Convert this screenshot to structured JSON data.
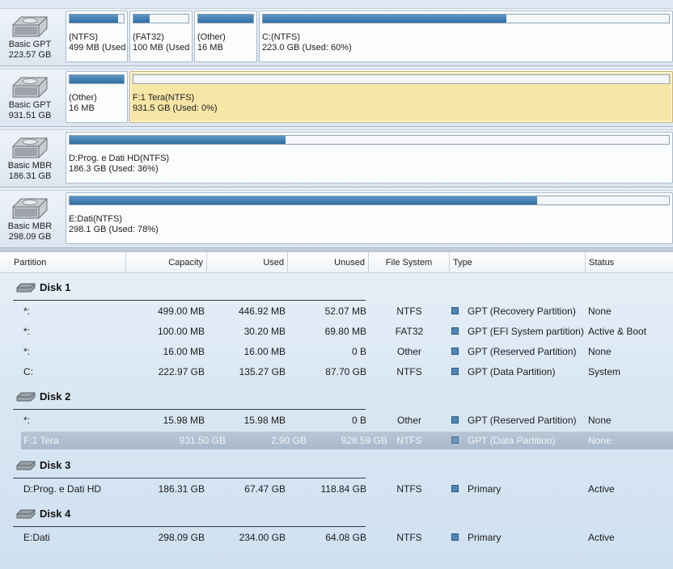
{
  "disks_map": [
    {
      "type": "Basic GPT",
      "size": "223.57 GB",
      "partitions": [
        {
          "name": "(NTFS)",
          "detail": "499 MB (Used:",
          "used_fraction": 0.9,
          "selected": false
        },
        {
          "name": "(FAT32)",
          "detail": "100 MB (Used:",
          "used_fraction": 0.3,
          "selected": false
        },
        {
          "name": "(Other)",
          "detail": "16 MB",
          "used_fraction": 1.0,
          "selected": false
        },
        {
          "name": "C:(NTFS)",
          "detail": "223.0 GB (Used: 60%)",
          "used_fraction": 0.6,
          "selected": false
        }
      ]
    },
    {
      "type": "Basic GPT",
      "size": "931.51 GB",
      "partitions": [
        {
          "name": "(Other)",
          "detail": "16 MB",
          "used_fraction": 1.0,
          "selected": false
        },
        {
          "name": "F:1 Tera(NTFS)",
          "detail": "931.5 GB (Used: 0%)",
          "used_fraction": 0.0,
          "selected": true
        }
      ]
    },
    {
      "type": "Basic MBR",
      "size": "186.31 GB",
      "partitions": [
        {
          "name": "D:Prog. e Dati HD(NTFS)",
          "detail": "186.3 GB (Used: 36%)",
          "used_fraction": 0.36,
          "selected": false
        }
      ]
    },
    {
      "type": "Basic MBR",
      "size": "298.09 GB",
      "partitions": [
        {
          "name": "E:Dati(NTFS)",
          "detail": "298.1 GB (Used: 78%)",
          "used_fraction": 0.78,
          "selected": false
        }
      ]
    }
  ],
  "table": {
    "columns": {
      "partition": "Partition",
      "capacity": "Capacity",
      "used": "Used",
      "unused": "Unused",
      "file_system": "File System",
      "type": "Type",
      "status": "Status"
    },
    "groups": [
      {
        "title": "Disk 1",
        "rows": [
          {
            "partition": "*:",
            "capacity": "499.00 MB",
            "used": "446.92 MB",
            "unused": "52.07 MB",
            "fs": "NTFS",
            "type": "GPT (Recovery Partition)",
            "status": "None"
          },
          {
            "partition": "*:",
            "capacity": "100.00 MB",
            "used": "30.20 MB",
            "unused": "69.80 MB",
            "fs": "FAT32",
            "type": "GPT (EFI System partition)",
            "status": "Active & Boot"
          },
          {
            "partition": "*:",
            "capacity": "16.00 MB",
            "used": "16.00 MB",
            "unused": "0 B",
            "fs": "Other",
            "type": "GPT (Reserved Partition)",
            "status": "None"
          },
          {
            "partition": "C:",
            "capacity": "222.97 GB",
            "used": "135.27 GB",
            "unused": "87.70 GB",
            "fs": "NTFS",
            "type": "GPT (Data Partition)",
            "status": "System"
          }
        ]
      },
      {
        "title": "Disk 2",
        "rows": [
          {
            "partition": "*:",
            "capacity": "15.98 MB",
            "used": "15.98 MB",
            "unused": "0 B",
            "fs": "Other",
            "type": "GPT (Reserved Partition)",
            "status": "None"
          },
          {
            "partition": "F:1 Tera",
            "capacity": "931.50 GB",
            "used": "2.90 GB",
            "unused": "928.59 GB",
            "fs": "NTFS",
            "type": "GPT (Data Partition)",
            "status": "None",
            "selected": true
          }
        ]
      },
      {
        "title": "Disk 3",
        "rows": [
          {
            "partition": "D:Prog. e Dati HD",
            "capacity": "186.31 GB",
            "used": "67.47 GB",
            "unused": "118.84 GB",
            "fs": "NTFS",
            "type": "Primary",
            "status": "Active"
          }
        ]
      },
      {
        "title": "Disk 4",
        "rows": [
          {
            "partition": "E:Dati",
            "capacity": "298.09 GB",
            "used": "234.00 GB",
            "unused": "64.08 GB",
            "fs": "NTFS",
            "type": "Primary",
            "status": "Active"
          }
        ]
      }
    ]
  },
  "colors": {
    "selected_partition": "#f7e6a6",
    "usage_fill": "#2e6ea5",
    "selected_row": "#aebccd"
  },
  "icons": {
    "disk": "hard-disk-icon",
    "type_marker": "partition-type-square-icon"
  }
}
